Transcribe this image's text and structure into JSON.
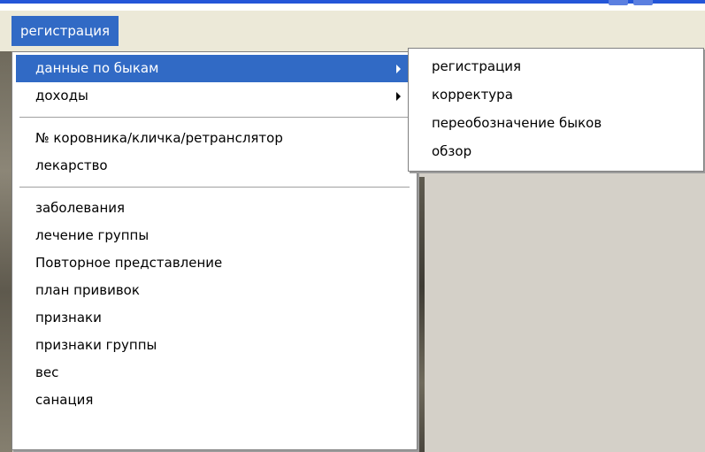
{
  "menubar": {
    "active_menu": "регистрация"
  },
  "main_menu": {
    "items": [
      {
        "label": "данные по быкам",
        "submenu": true,
        "highlighted": true
      },
      {
        "label": "доходы",
        "submenu": true
      },
      {
        "separator": true
      },
      {
        "label": "№ коровника/кличка/ретранслятор"
      },
      {
        "label": "лекарство"
      },
      {
        "separator": true
      },
      {
        "label": "заболевания"
      },
      {
        "label": "лечение группы"
      },
      {
        "label": "Повторное представление"
      },
      {
        "label": "план прививок"
      },
      {
        "label": "признаки"
      },
      {
        "label": "признаки группы"
      },
      {
        "label": "вес"
      },
      {
        "label": "санация"
      }
    ]
  },
  "submenu": {
    "items": [
      {
        "label": "регистрация"
      },
      {
        "label": "корректура"
      },
      {
        "label": "переобозначение быков"
      },
      {
        "label": "обзор"
      }
    ]
  },
  "colors": {
    "highlight": "#316ac5",
    "menu_background": "#ffffff",
    "menubar_background": "#ece9d8",
    "workspace": "#d4d0c8"
  }
}
